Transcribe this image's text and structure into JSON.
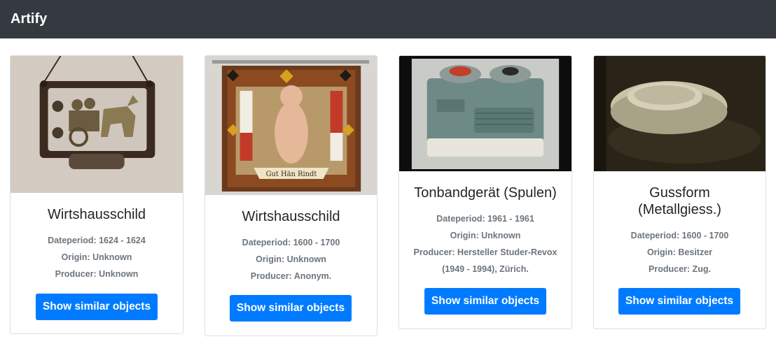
{
  "navbar": {
    "brand": "Artify"
  },
  "cards": [
    {
      "title": "Wirtshausschild",
      "dateperiod": "Dateperiod: 1624 - 1624",
      "origin": "Origin: Unknown",
      "producer": "Producer: Unknown",
      "button": "Show similar objects"
    },
    {
      "title": "Wirtshausschild",
      "dateperiod": "Dateperiod: 1600 - 1700",
      "origin": "Origin: Unknown",
      "producer": "Producer: Anonym.",
      "button": "Show similar objects",
      "image_text": "Gut Hän Rindt"
    },
    {
      "title": "Tonbandgerät (Spulen)",
      "dateperiod": "Dateperiod: 1961 - 1961",
      "origin": "Origin: Unknown",
      "producer_line1": "Producer: Hersteller Studer-Revox",
      "producer_line2": "(1949 - 1994), Zürich.",
      "button": "Show similar objects"
    },
    {
      "title_line1": "Gussform",
      "title_line2": "(Metallgiess.)",
      "dateperiod": "Dateperiod: 1600 - 1700",
      "origin": "Origin: Besitzer",
      "producer": "Producer: Zug.",
      "button": "Show similar objects"
    }
  ]
}
